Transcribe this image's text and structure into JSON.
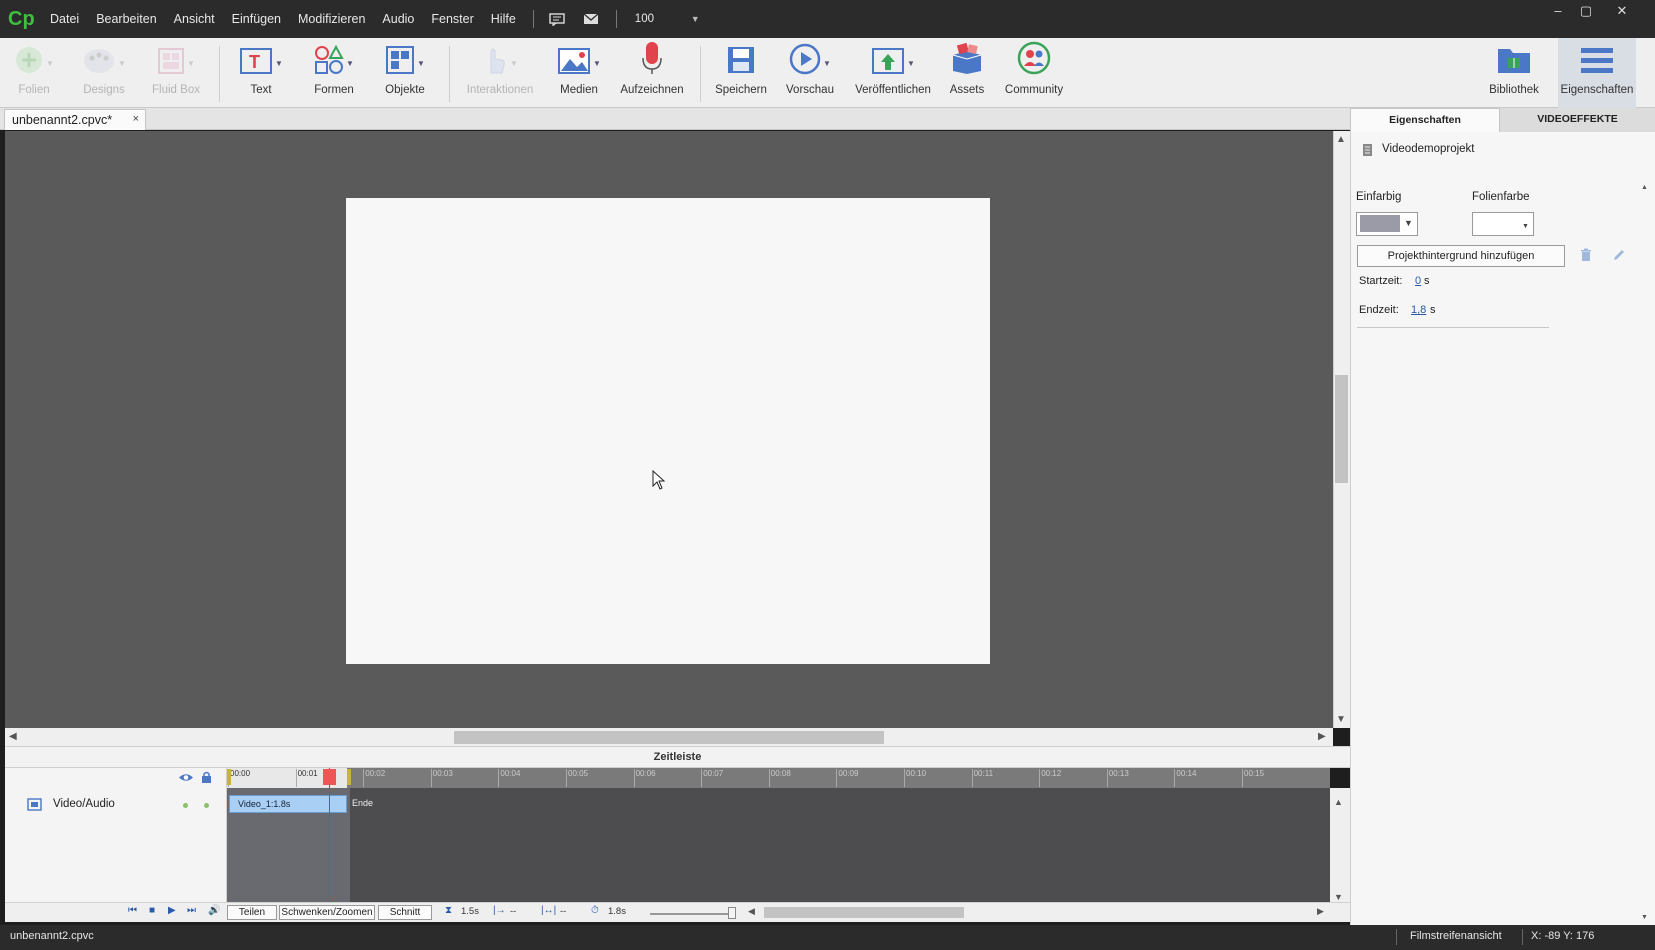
{
  "app": {
    "logo": "Cp"
  },
  "menu": {
    "items": [
      "Datei",
      "Bearbeiten",
      "Ansicht",
      "Einfügen",
      "Modifizieren",
      "Audio",
      "Fenster",
      "Hilfe"
    ],
    "zoom": "100"
  },
  "window_controls": {
    "minimize": "–",
    "maximize": "▢",
    "close": "✕"
  },
  "toolbar": {
    "folien": "Folien",
    "designs": "Designs",
    "fluid_box": "Fluid Box",
    "text": "Text",
    "formen": "Formen",
    "objekte": "Objekte",
    "interaktionen": "Interaktionen",
    "medien": "Medien",
    "aufzeichnen": "Aufzeichnen",
    "speichern": "Speichern",
    "vorschau": "Vorschau",
    "veroeffentlichen": "Veröffentlichen",
    "assets": "Assets",
    "community": "Community",
    "bibliothek": "Bibliothek",
    "eigenschaften": "Eigenschaften"
  },
  "document": {
    "tab_title": "unbenannt2.cpvc*",
    "close": "×"
  },
  "timeline": {
    "title": "Zeitleiste",
    "track_name": "Video/Audio",
    "clip_label": "Video_1:1.8s",
    "end_label": "Ende",
    "ticks": [
      "00:00",
      "00:01",
      "00:02",
      "00:03",
      "00:04",
      "00:05",
      "00:06",
      "00:07",
      "00:08",
      "00:09",
      "00:10",
      "00:11",
      "00:12",
      "00:13",
      "00:14",
      "00:15"
    ],
    "buttons": {
      "teilen": "Teilen",
      "schwenken": "Schwenken/Zoomen",
      "schnitt": "Schnitt"
    },
    "duration": "1.5s",
    "in_point": "--",
    "out_point": "--",
    "total": "1.8s"
  },
  "properties": {
    "tab_props": "Eigenschaften",
    "tab_video": "VIDEOEFFEKTE",
    "project_name": "Videodemoprojekt",
    "einfarbig": "Einfarbig",
    "folienfarbe": "Folienfarbe",
    "add_bg_button": "Projekthintergrund hinzufügen",
    "startzeit_label": "Startzeit:",
    "startzeit_value": "0",
    "endzeit_label": "Endzeit:",
    "endzeit_value": "1,8",
    "unit": "s",
    "solid_color": "#9a9ba6"
  },
  "status": {
    "file": "unbenannt2.cpvc",
    "view": "Filmstreifenansicht",
    "coords": "X: -89 Y: 176"
  }
}
